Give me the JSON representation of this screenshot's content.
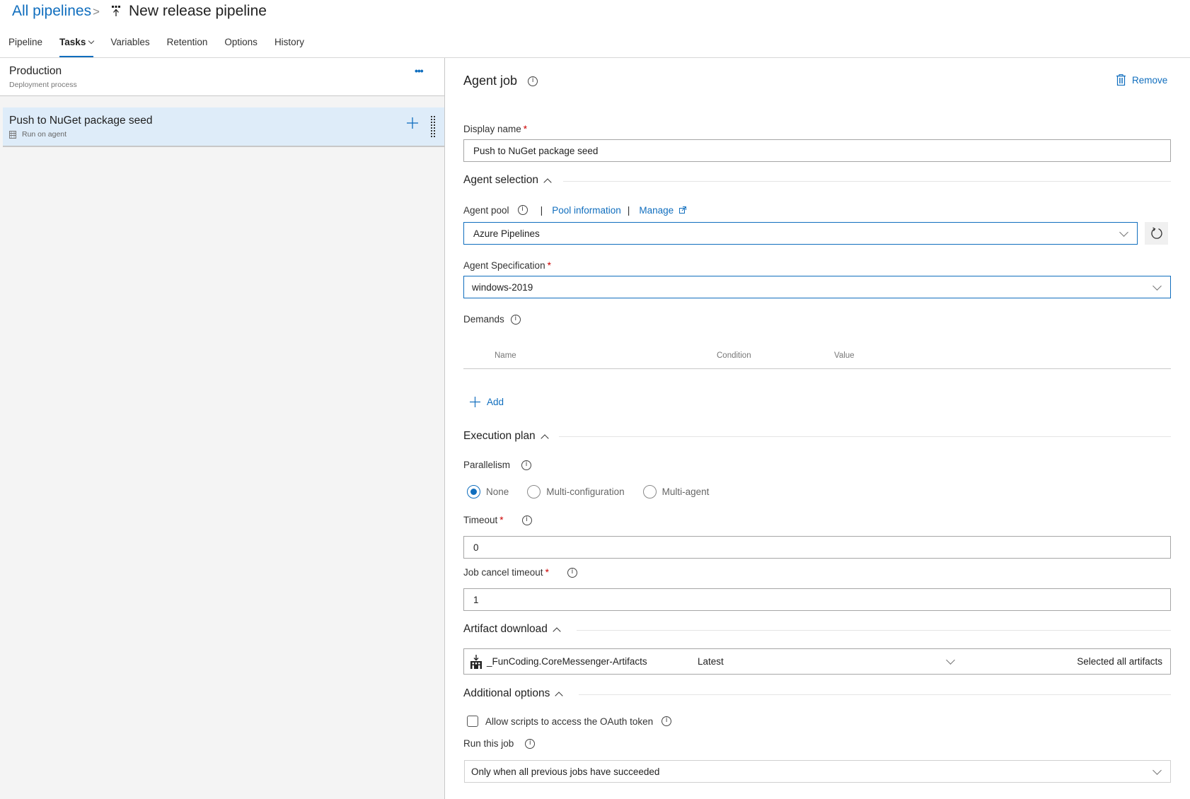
{
  "breadcrumb": {
    "parent": "All pipelines",
    "separator": ">",
    "icon": "release-pipeline-icon",
    "title": "New release pipeline"
  },
  "tabs": [
    {
      "label": "Pipeline",
      "active": false
    },
    {
      "label": "Tasks",
      "active": true,
      "has_dropdown": true
    },
    {
      "label": "Variables",
      "active": false
    },
    {
      "label": "Retention",
      "active": false
    },
    {
      "label": "Options",
      "active": false
    },
    {
      "label": "History",
      "active": false
    }
  ],
  "left_pane": {
    "stage": {
      "name": "Production",
      "subtitle": "Deployment process",
      "more_label": "•••"
    },
    "job": {
      "name": "Push to NuGet package seed",
      "subtitle": "Run on agent",
      "subtitle_icon": "server-icon"
    }
  },
  "agent_job": {
    "title": "Agent job",
    "remove_label": "Remove",
    "display_name": {
      "label": "Display name",
      "required_mark": "*",
      "value": "Push to NuGet package seed"
    },
    "agent_selection": {
      "heading": "Agent selection",
      "agent_pool": {
        "label": "Agent pool",
        "pool_info_link": "Pool information",
        "manage_link": "Manage",
        "separator": "|",
        "value": "Azure Pipelines"
      },
      "agent_specification": {
        "label": "Agent Specification",
        "required_mark": "*",
        "value": "windows-2019"
      },
      "demands": {
        "label": "Demands",
        "columns": [
          "Name",
          "Condition",
          "Value"
        ],
        "rows": [],
        "add_label": "Add"
      }
    },
    "execution_plan": {
      "heading": "Execution plan",
      "parallelism": {
        "label": "Parallelism",
        "options": [
          {
            "label": "None",
            "selected": true
          },
          {
            "label": "Multi-configuration",
            "selected": false
          },
          {
            "label": "Multi-agent",
            "selected": false
          }
        ]
      },
      "timeout": {
        "label": "Timeout",
        "required_mark": "*",
        "value": "0"
      },
      "job_cancel_timeout": {
        "label": "Job cancel timeout",
        "required_mark": "*",
        "value": "1"
      }
    },
    "artifact_download": {
      "heading": "Artifact download",
      "artifact": {
        "name": "_FunCoding.CoreMessenger-Artifacts",
        "version": "Latest",
        "selection": "Selected all artifacts"
      }
    },
    "additional_options": {
      "heading": "Additional options",
      "oauth_checkbox": {
        "label": "Allow scripts to access the OAuth token",
        "checked": false
      },
      "run_this_job": {
        "label": "Run this job",
        "value": "Only when all previous jobs have succeeded"
      }
    }
  },
  "colors": {
    "accent": "#106ebe",
    "selected_row": "#deecf9",
    "left_pane_bg": "#f4f4f4",
    "required": "#cc0000"
  }
}
